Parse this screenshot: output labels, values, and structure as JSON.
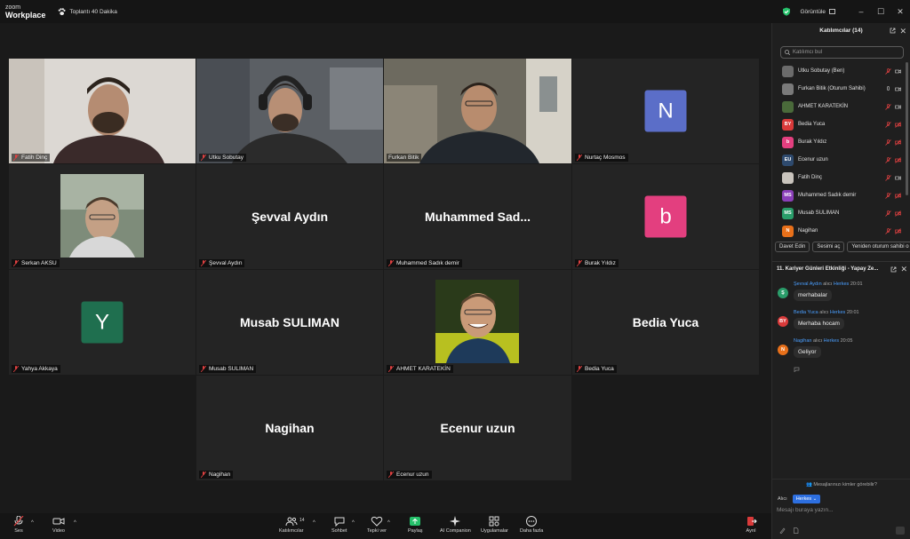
{
  "titlebar": {
    "logo_top": "zoom",
    "logo_bottom": "Workplace",
    "meeting_timer": "Toplantı 40 Dakika",
    "view_label": "Görüntüle",
    "security_color": "#25c06a"
  },
  "tiles": [
    {
      "name": "Fatih Dinç",
      "kind": "camera",
      "bg": "#d9d6d3"
    },
    {
      "name": "Utku Sobutay",
      "kind": "camera",
      "bg": "#5a5e63"
    },
    {
      "name": "Furkan Bitik",
      "kind": "camera",
      "bg": "#6e6a5e",
      "active": true
    },
    {
      "name": "Nurtaç Mosmos",
      "kind": "avatar",
      "letter": "N",
      "color": "#5b6ec8"
    },
    {
      "name": "Serkan AKSU",
      "kind": "photo"
    },
    {
      "name": "Şevval Aydın",
      "kind": "text",
      "display": "Şevval Aydın"
    },
    {
      "name": "Muhammed Sadık demir",
      "kind": "text",
      "display": "Muhammed  Sad..."
    },
    {
      "name": "Burak Yıldız",
      "kind": "avatar",
      "letter": "b",
      "color": "#e33f7f"
    },
    {
      "name": "Yahya Akkaya",
      "kind": "avatar",
      "letter": "Y",
      "color": "#1f6f4f"
    },
    {
      "name": "Musab SULIMAN",
      "kind": "text",
      "display": "Musab SULIMAN"
    },
    {
      "name": "AHMET KARATEKİN",
      "kind": "photo"
    },
    {
      "name": "Bedia Yuca",
      "kind": "text",
      "display": "Bedia Yuca"
    },
    {
      "name": "Nagihan",
      "kind": "text",
      "display": "Nagihan"
    },
    {
      "name": "Ecenur uzun",
      "kind": "text",
      "display": "Ecenur uzun"
    }
  ],
  "toolbar": {
    "audio": "Ses",
    "video": "Video",
    "participants": "Katılımcılar",
    "participants_count": "14",
    "chat": "Sohbet",
    "reactions": "Tepki ver",
    "share": "Paylaş",
    "ai": "AI Companion",
    "apps": "Uygulamalar",
    "more": "Daha fazla",
    "leave": "Ayrıl"
  },
  "participants_panel": {
    "title": "Katılımcılar (14)",
    "search_placeholder": "Katılımcı bul",
    "rows": [
      {
        "name": "Utku Sobutay (Ben)",
        "initials": "",
        "color": "#6b6b6b",
        "mic": "muted",
        "video": "on"
      },
      {
        "name": "Furkan Bitik (Oturum Sahibi)",
        "initials": "",
        "color": "#7a7a7a",
        "mic": "on",
        "video": "on"
      },
      {
        "name": "AHMET KARATEKİN",
        "initials": "",
        "color": "#4a6a3a",
        "mic": "muted",
        "video": "on"
      },
      {
        "name": "Bedia Yuca",
        "initials": "BY",
        "color": "#d93a3a",
        "mic": "muted",
        "video": "off"
      },
      {
        "name": "Burak Yıldız",
        "initials": "b",
        "color": "#e33f7f",
        "mic": "muted",
        "video": "off"
      },
      {
        "name": "Ecenur uzun",
        "initials": "EU",
        "color": "#2e4a6e",
        "mic": "muted",
        "video": "off"
      },
      {
        "name": "Fatih Dinç",
        "initials": "",
        "color": "#c9c4bd",
        "mic": "muted",
        "video": "on"
      },
      {
        "name": "Muhammed Sadık demir",
        "initials": "MS",
        "color": "#8a3fb8",
        "mic": "muted",
        "video": "off"
      },
      {
        "name": "Musab SULIMAN",
        "initials": "MS",
        "color": "#2a9d6a",
        "mic": "muted",
        "video": "off"
      },
      {
        "name": "Nagihan",
        "initials": "N",
        "color": "#e8701a",
        "mic": "muted",
        "video": "off"
      }
    ],
    "actions": [
      "Davet Edin",
      "Sesimi aç",
      "Yeniden oturum sahibi o"
    ]
  },
  "chat_panel": {
    "title": "11. Kariyer Günleri Etkinliği - Yapay Ze...",
    "to_word": "alıcı",
    "messages": [
      {
        "from": "Şevval Aydın",
        "to": "Herkes",
        "time": "20:01",
        "text": "merhabalar",
        "initials": "Ş",
        "color": "#2a9d6a"
      },
      {
        "from": "Bedia Yuca",
        "to": "Herkes",
        "time": "20:01",
        "text": "Merhaba hocam",
        "initials": "BY",
        "color": "#d93a3a"
      },
      {
        "from": "Nagihan",
        "to": "Herkes",
        "time": "20:05",
        "text": "Geliyor",
        "initials": "N",
        "color": "#e8701a"
      }
    ],
    "visibility_note": "Mesajlarınızı kimler görebilir?",
    "recipient_label": "Alıcı",
    "recipient_value": "Herkes ⌄",
    "input_placeholder": "Mesajı buraya yazın..."
  }
}
